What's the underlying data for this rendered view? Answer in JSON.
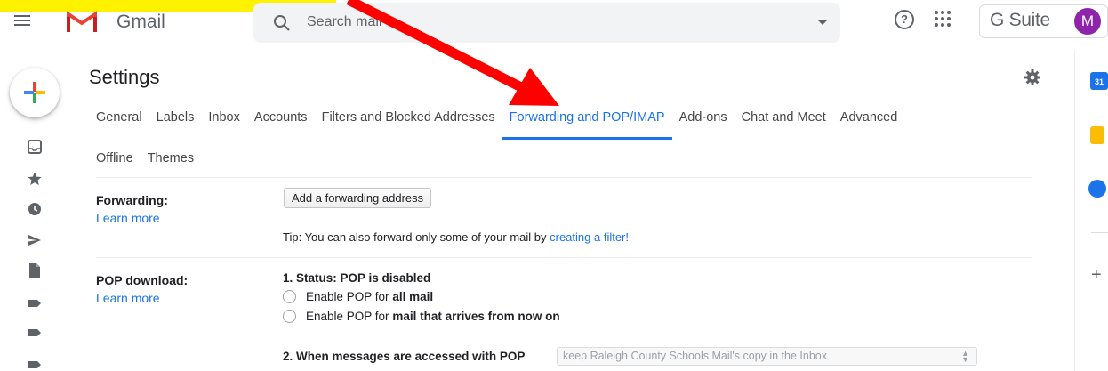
{
  "header": {
    "app_name": "Gmail",
    "search_placeholder": "Search mail",
    "help_symbol": "?",
    "brand": "G Suite",
    "avatar_initial": "M"
  },
  "settings": {
    "title": "Settings",
    "tabs_row1": [
      "General",
      "Labels",
      "Inbox",
      "Accounts",
      "Filters and Blocked Addresses",
      "Forwarding and POP/IMAP",
      "Add-ons",
      "Chat and Meet",
      "Advanced"
    ],
    "tabs_row2": [
      "Offline",
      "Themes"
    ],
    "active_tab": "Forwarding and POP/IMAP"
  },
  "forwarding": {
    "label": "Forwarding:",
    "learn_more": "Learn more",
    "button": "Add a forwarding address",
    "tip_prefix": "Tip: You can also forward only some of your mail by ",
    "tip_link": "creating a filter!"
  },
  "pop": {
    "label": "POP download:",
    "learn_more": "Learn more",
    "status": "1. Status: POP is disabled",
    "option1_prefix": "Enable POP for ",
    "option1_bold": "all mail",
    "option2_prefix": "Enable POP for ",
    "option2_bold": "mail that arrives from now on",
    "access_label": "2. When messages are accessed with POP",
    "access_value": "keep Raleigh County Schools Mail's copy in the Inbox"
  },
  "right_rail": {
    "calendar_day": "31"
  },
  "colors": {
    "accent": "#1a73e8",
    "arrow": "#ff0000",
    "highlight": "#fff200",
    "avatar": "#8e24aa"
  }
}
